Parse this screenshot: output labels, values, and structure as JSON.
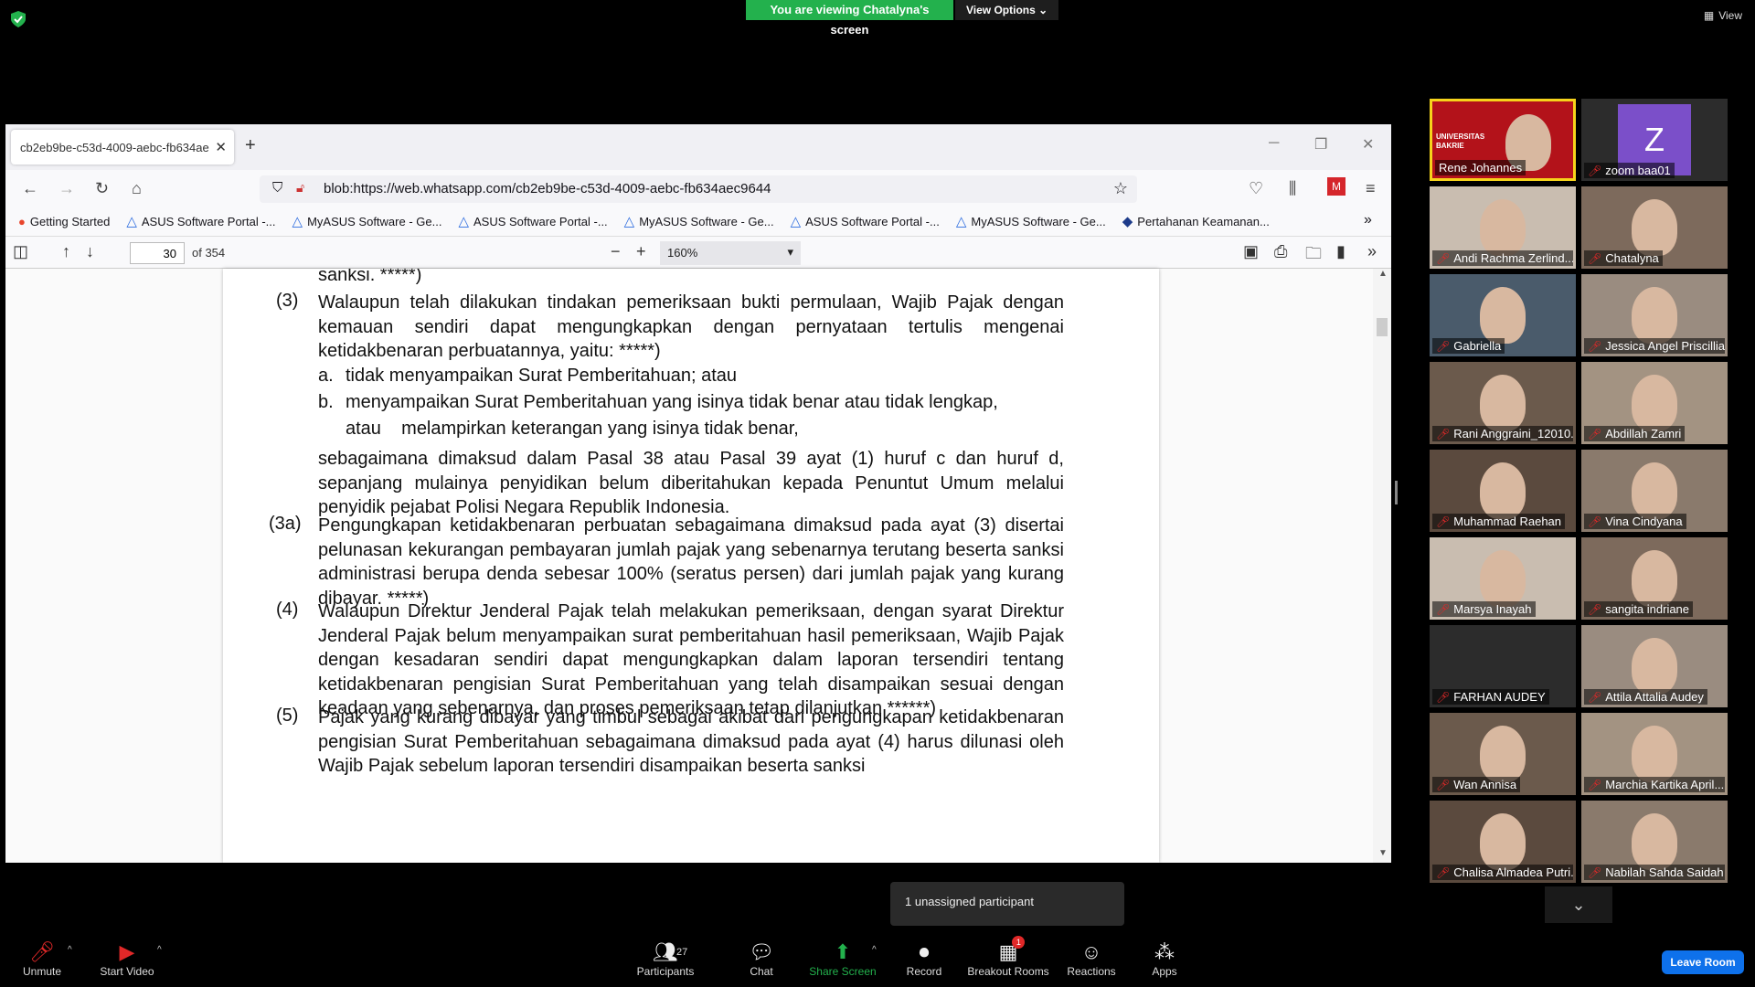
{
  "zoom": {
    "viewing_label": "You are viewing Chatalyna's screen",
    "view_options": "View Options",
    "view_top": "View",
    "unassigned_tooltip": "1 unassigned participant",
    "toolbar": {
      "unmute": "Unmute",
      "start_video": "Start Video",
      "participants": "Participants",
      "participants_count": "27",
      "chat": "Chat",
      "share_screen": "Share Screen",
      "record": "Record",
      "breakout_rooms": "Breakout Rooms",
      "breakout_badge": "1",
      "reactions": "Reactions",
      "apps": "Apps",
      "leave": "Leave Room"
    },
    "participants": [
      {
        "name": "Rene Johannes",
        "video": true,
        "active": true,
        "banner": "UNIVERSITAS BAKRIE"
      },
      {
        "name": "zoom baa01",
        "video": false,
        "avatar": "Z"
      },
      {
        "name": "Andi Rachma Zerlind...",
        "video": true
      },
      {
        "name": "Chatalyna",
        "video": true
      },
      {
        "name": "Gabriella",
        "video": true
      },
      {
        "name": "Jessica Angel Priscillia",
        "video": true
      },
      {
        "name": "Rani Anggraini_12010...",
        "video": true
      },
      {
        "name": "Abdillah Zamri",
        "video": true
      },
      {
        "name": "Muhammad Raehan",
        "video": true
      },
      {
        "name": "Vina Cindyana",
        "video": true
      },
      {
        "name": "Marsya Inayah",
        "video": true
      },
      {
        "name": "sangita indriane",
        "video": true
      },
      {
        "name": "FARHAN AUDEY",
        "video": false
      },
      {
        "name": "Attila Attalia Audey",
        "video": true
      },
      {
        "name": "Wan Annisa",
        "video": true
      },
      {
        "name": "Marchia Kartika April...",
        "video": true
      },
      {
        "name": "Chalisa Almadea Putri...",
        "video": true
      },
      {
        "name": "Nabilah Sahda Saidah",
        "video": true
      }
    ]
  },
  "browser": {
    "tab_title": "cb2eb9be-c53d-4009-aebc-fb634ae",
    "url": "blob:https://web.whatsapp.com/cb2eb9be-c53d-4009-aebc-fb634aec9644",
    "bookmarks": [
      "Getting Started",
      "ASUS Software Portal -...",
      "MyASUS Software - Ge...",
      "ASUS Software Portal -...",
      "MyASUS Software - Ge...",
      "ASUS Software Portal -...",
      "MyASUS Software - Ge...",
      "Pertahanan Keamanan..."
    ],
    "pdf": {
      "page": "30",
      "of": "of 354",
      "zoom": "160%"
    }
  },
  "document": {
    "top_fragment": "sanksi. *****)",
    "p3_num": "(3)",
    "p3_text": "Walaupun telah dilakukan tindakan pemeriksaan bukti permulaan, Wajib Pajak dengan kemauan sendiri dapat mengungkapkan dengan pernyataan tertulis mengenai ketidakbenaran perbuatannya, yaitu: *****)",
    "item_a_label": "a.",
    "item_a": "tidak menyampaikan Surat Pemberitahuan; atau",
    "item_b_label": "b.",
    "item_b_line1": "menyampaikan Surat Pemberitahuan yang isinya tidak benar atau tidak lengkap,",
    "item_b_line2": "atau    melampirkan keterangan yang isinya tidak benar,",
    "p3_cont": "sebagaimana dimaksud dalam Pasal 38 atau Pasal 39 ayat (1) huruf c dan huruf d, sepanjang mulainya penyidikan belum diberitahukan kepada Penuntut Umum melalui penyidik pejabat Polisi Negara Republik Indonesia.",
    "p3a_num": "(3a)",
    "p3a_text": "Pengungkapan ketidakbenaran perbuatan sebagaimana dimaksud pada ayat (3) disertai pelunasan kekurangan pembayaran jumlah pajak yang sebenarnya terutang beserta sanksi administrasi berupa denda sebesar 100% (seratus persen) dari jumlah pajak yang kurang dibayar. *****)",
    "p4_num": "(4)",
    "p4_text": "Walaupun Direktur Jenderal Pajak telah melakukan pemeriksaan, dengan syarat Direktur Jenderal Pajak belum menyampaikan surat pemberitahuan hasil pemeriksaan, Wajib Pajak dengan kesadaran sendiri dapat mengungkapkan dalam laporan tersendiri tentang ketidakbenaran pengisian Surat Pemberitahuan yang telah disampaikan sesuai dengan keadaan yang sebenarnya, dan proses pemeriksaan tetap dilanjutkan ******)",
    "p5_num": "(5)",
    "p5_text": "Pajak yang kurang dibayar yang timbul sebagai akibat dari pengungkapan ketidakbenaran pengisian Surat Pemberitahuan sebagaimana dimaksud pada ayat (4) harus dilunasi oleh Wajib Pajak sebelum laporan tersendiri disampaikan beserta sanksi"
  }
}
